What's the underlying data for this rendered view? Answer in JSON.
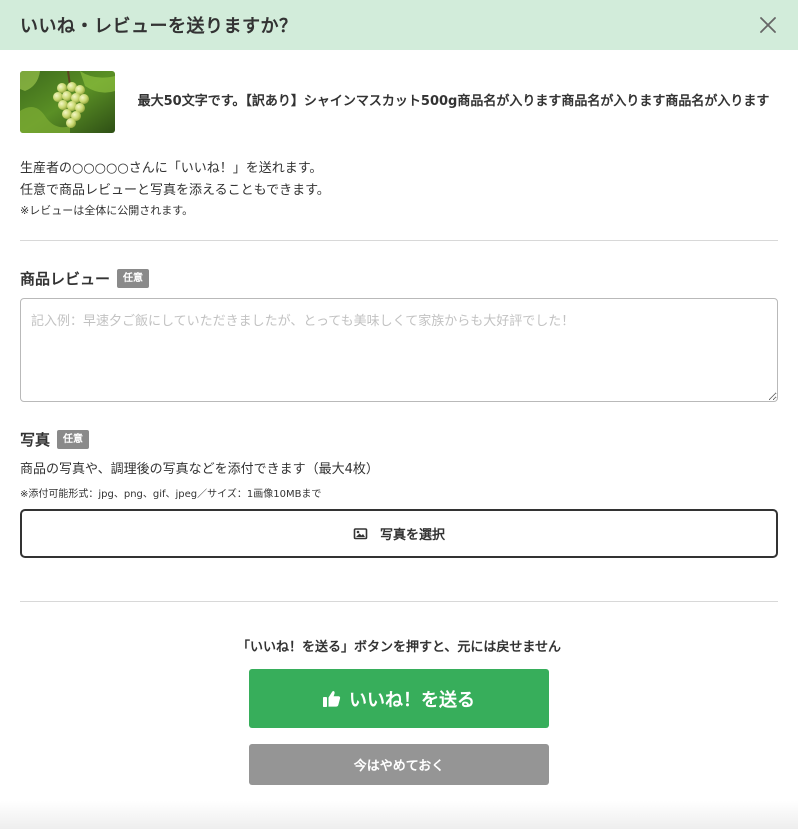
{
  "header": {
    "title": "いいね・レビューを送りますか？",
    "close_icon": "close-icon"
  },
  "product": {
    "name": "最大50文字です。【訳あり】シャインマスカット500g商品名が入ります商品名が入ります商品名が入ります",
    "image_icon": "grape-image"
  },
  "intro": {
    "line1": "生産者の○○○○○さんに「いいね！」を送れます。",
    "line2": "任意で商品レビューと写真を添えることもできます。",
    "note": "※レビューは全体に公開されます。"
  },
  "review": {
    "label": "商品レビュー",
    "badge": "任意",
    "placeholder": "記入例：早速夕ご飯にしていただきましたが、とっても美味しくて家族からも大好評でした！"
  },
  "photo": {
    "label": "写真",
    "badge": "任意",
    "description": "商品の写真や、調理後の写真などを添付できます（最大4枚）",
    "formats": "※添付可能形式：jpg、png、gif、jpeg／サイズ：1画像10MBまで",
    "select_label": "写真を選択",
    "select_icon": "image-icon"
  },
  "footer": {
    "warning": "「いいね！を送る」ボタンを押すと、元には戻せません",
    "submit_label": "いいね！を送る",
    "submit_icon": "thumbs-up-icon",
    "cancel_label": "今はやめておく"
  },
  "colors": {
    "header_bg": "#d2ecda",
    "submit_bg": "#37ae5b",
    "cancel_bg": "#959595",
    "badge_bg": "#8a8a8a"
  }
}
